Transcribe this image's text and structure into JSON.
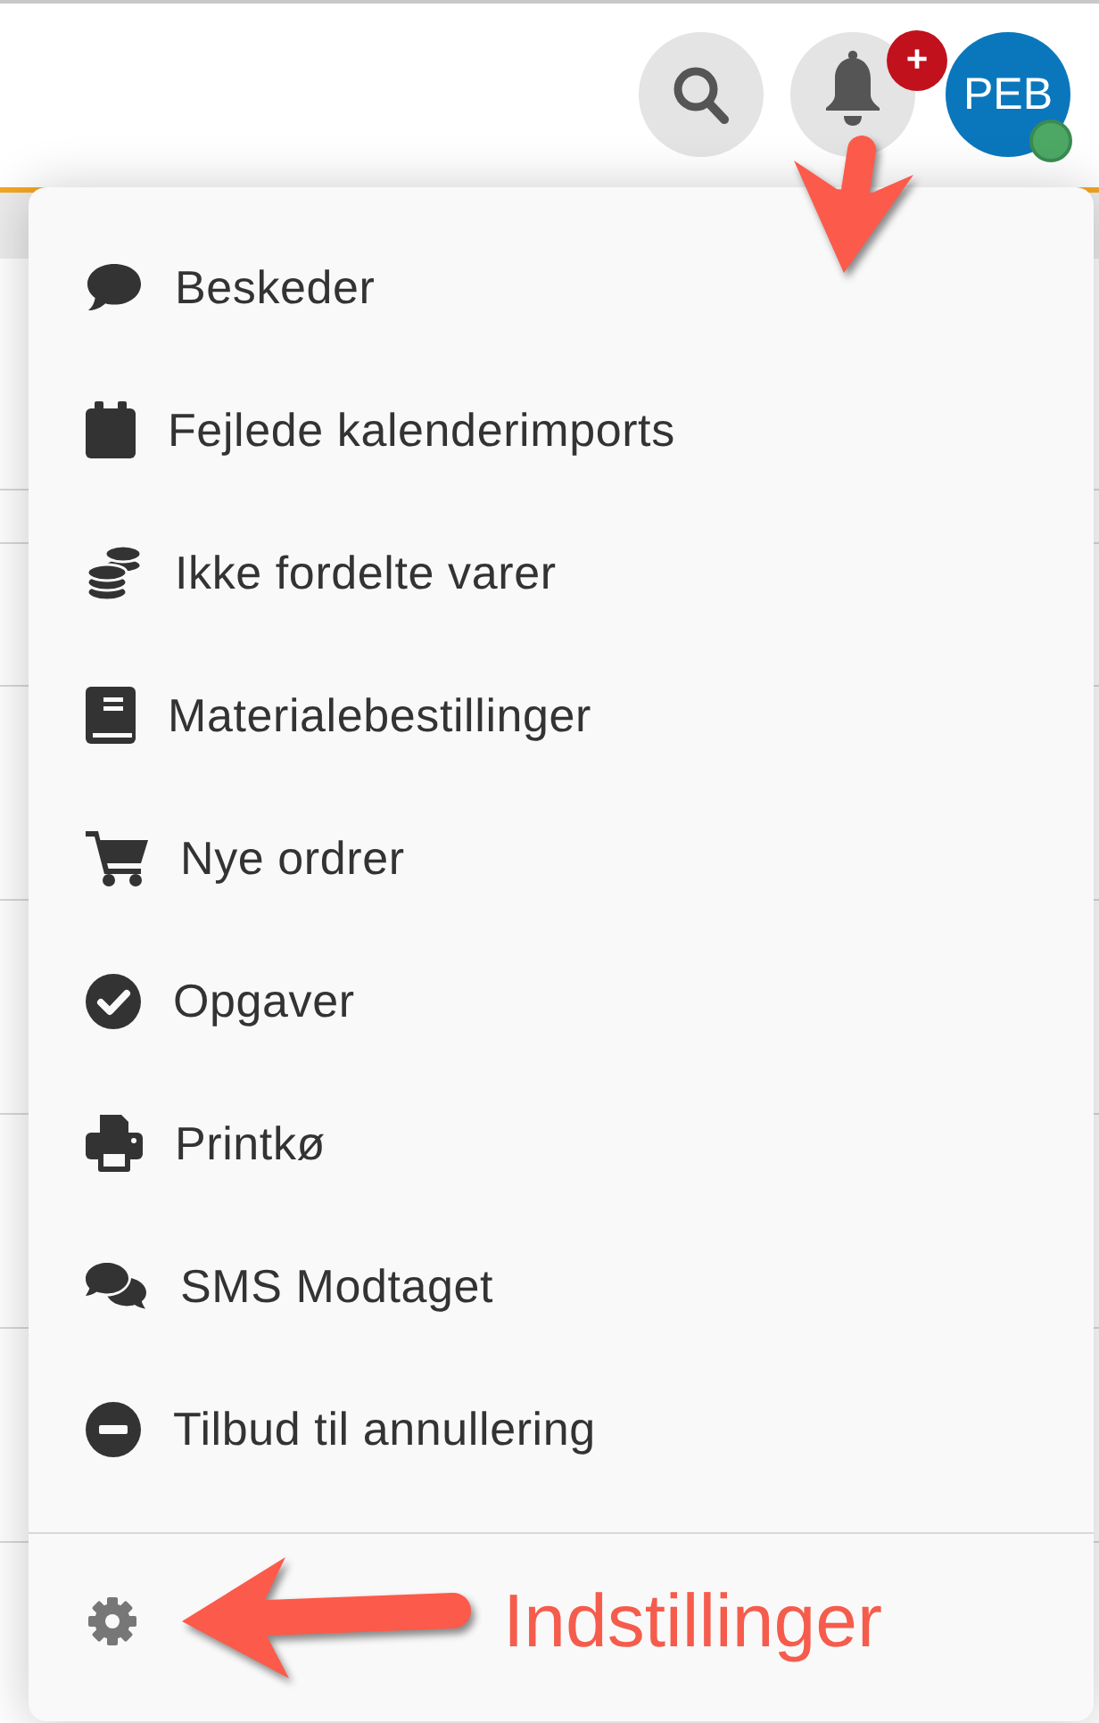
{
  "header": {
    "notification_badge": "+",
    "user": {
      "initials": "PEB",
      "online": true
    }
  },
  "menu": {
    "items": [
      {
        "label": "Beskeder"
      },
      {
        "label": "Fejlede kalenderimports"
      },
      {
        "label": "Ikke fordelte varer"
      },
      {
        "label": "Materialebestillinger"
      },
      {
        "label": "Nye ordrer"
      },
      {
        "label": "Opgaver"
      },
      {
        "label": "Printkø"
      },
      {
        "label": "SMS Modtaget"
      },
      {
        "label": "Tilbud til annullering"
      }
    ]
  },
  "annotation": {
    "label": "Indstillinger"
  }
}
